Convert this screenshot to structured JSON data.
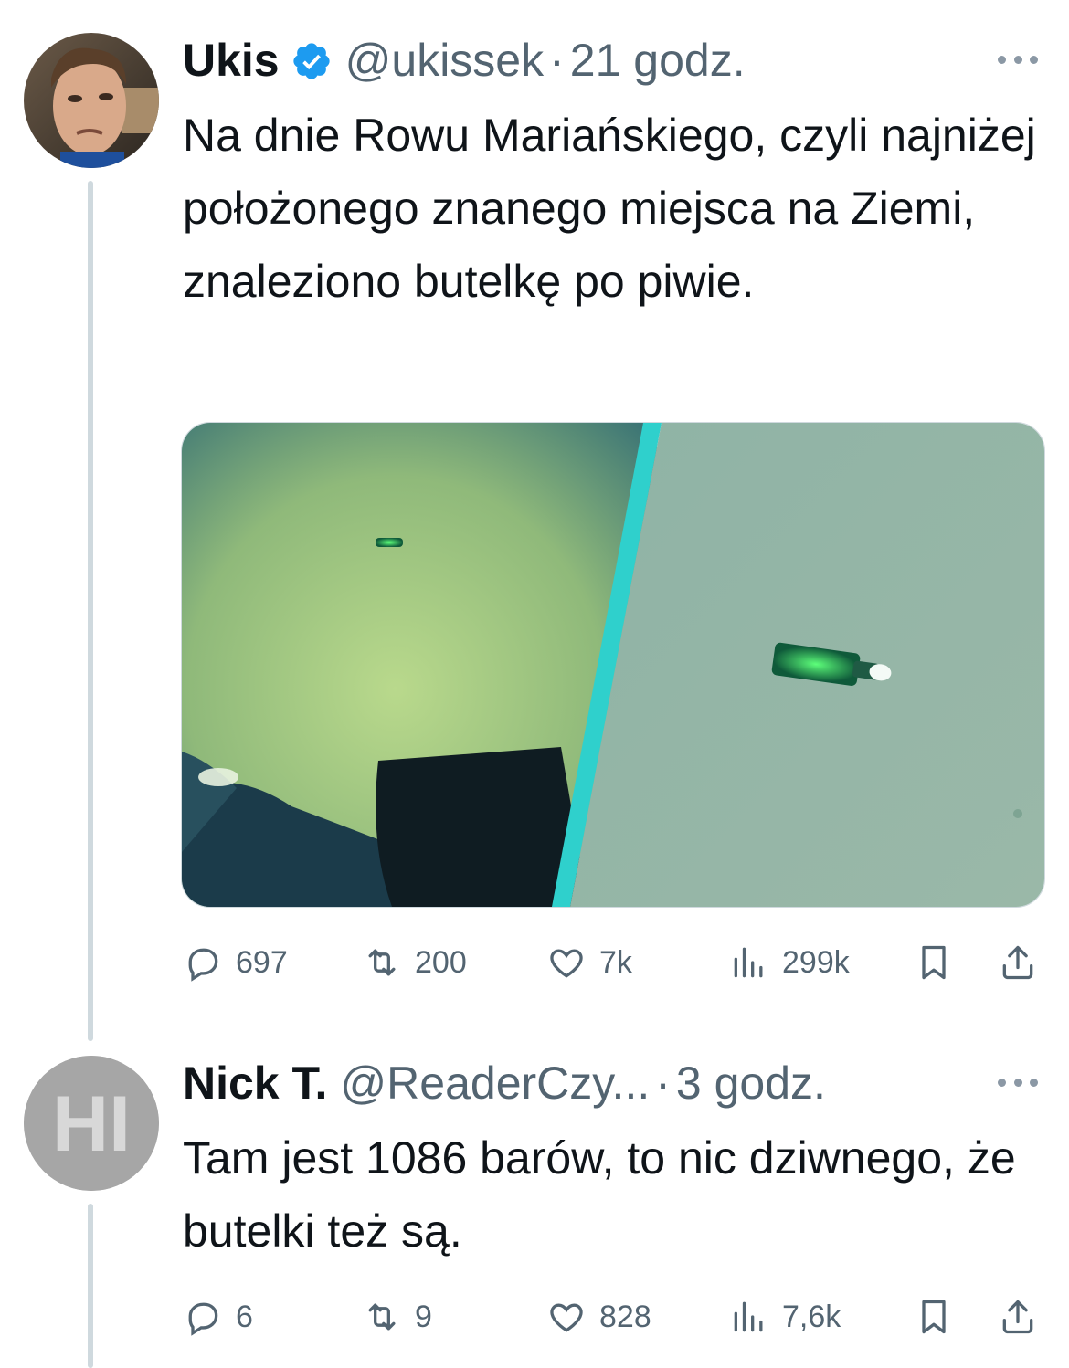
{
  "tweets": [
    {
      "name": "Ukis",
      "verified": true,
      "handle": "@ukissek",
      "time": "21 godz.",
      "text": "Na dnie Rowu Mariańskiego, czyli najniżej położonego znanego miejsca na Ziemi, znaleziono butelkę po piwie.",
      "stats": {
        "replies": "697",
        "retweets": "200",
        "likes": "7k",
        "views": "299k"
      }
    },
    {
      "name": "Nick T.",
      "handle": "@ReaderCzy...",
      "time": "3 godz.",
      "avatar_text": "HI",
      "text": "Tam jest 1086 barów, to nic dziwnego, że butelki też są.",
      "stats": {
        "replies": "6",
        "retweets": "9",
        "likes": "828",
        "views": "7,6k"
      }
    }
  ],
  "icons": {
    "reply": "speech-bubble-icon",
    "retweet": "retweet-arrows-icon",
    "like": "heart-icon",
    "views": "bar-chart-icon",
    "bookmark": "bookmark-icon",
    "share": "share-upload-icon",
    "more": "ellipsis-icon",
    "verified": "verified-badge-icon"
  },
  "colors": {
    "text": "#0f1419",
    "secondary": "#536471",
    "verified": "#1d9bf0",
    "thread_line": "#cfd9de"
  }
}
